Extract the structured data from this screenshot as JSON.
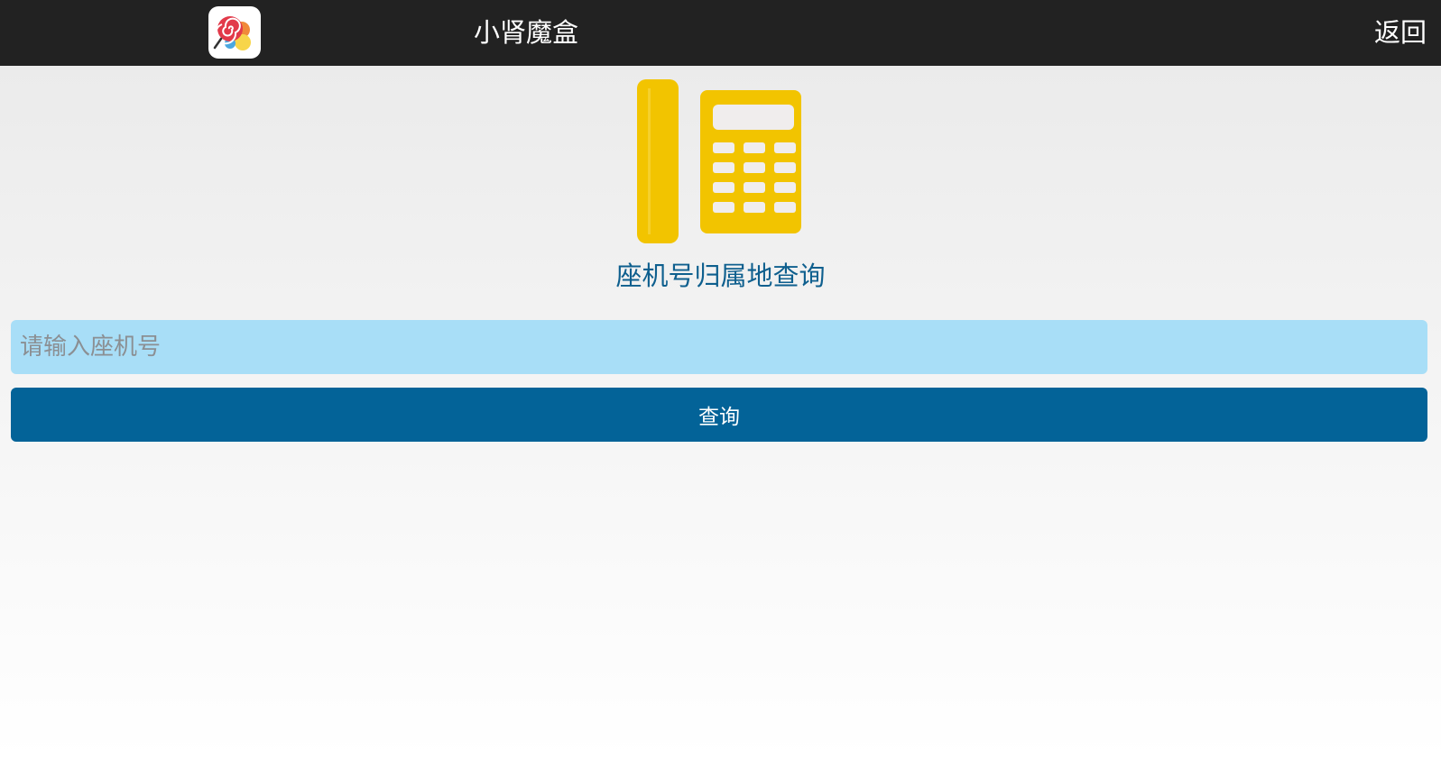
{
  "header": {
    "app_icon": "lollipop-candy-app-icon",
    "title": "小肾魔盒",
    "back_label": "返回"
  },
  "main": {
    "hero_icon": "desk-phone-icon",
    "title": "座机号归属地查询",
    "input": {
      "placeholder": "请输入座机号",
      "value": ""
    },
    "query_button_label": "查询"
  },
  "colors": {
    "header_bg": "#222222",
    "icon_yellow": "#f2c400",
    "title_blue": "#0e5f8e",
    "input_bg": "#a8def7",
    "button_bg": "#036398"
  }
}
